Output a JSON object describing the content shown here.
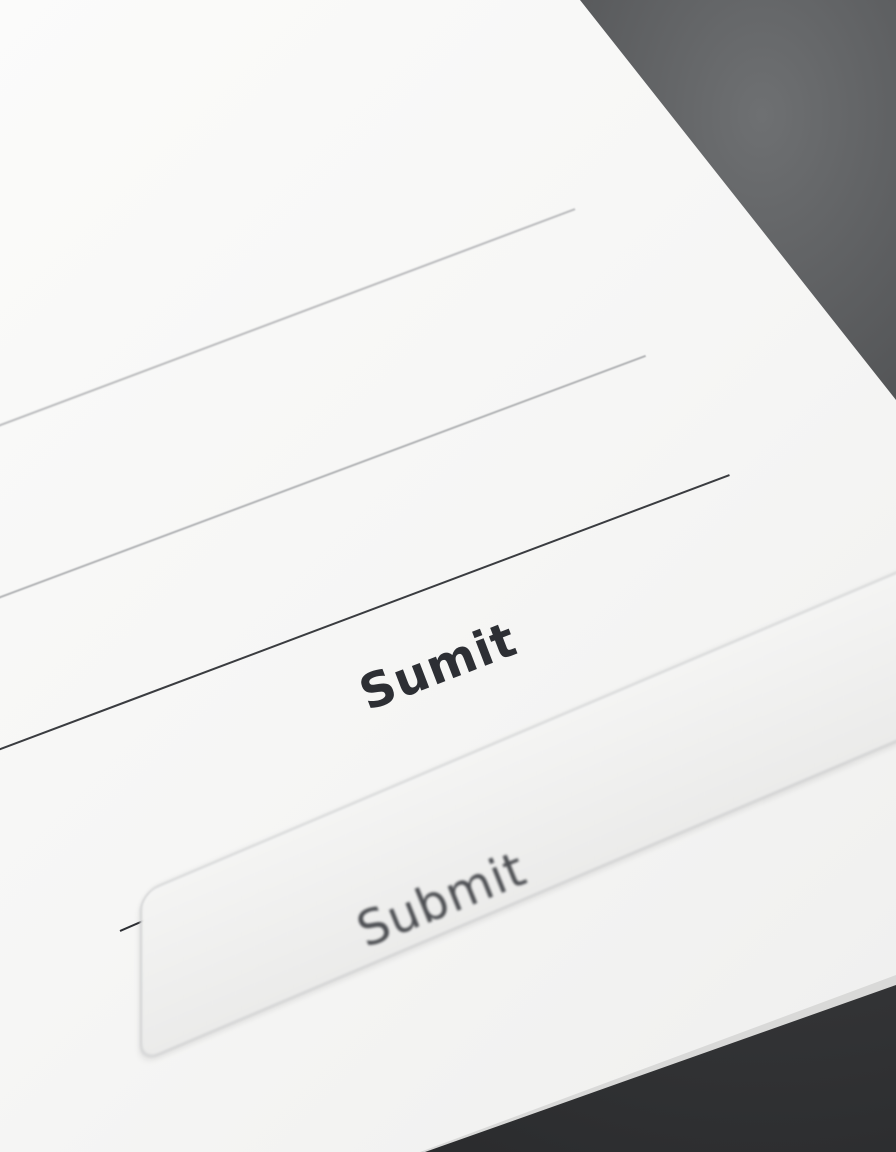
{
  "form": {
    "primary_button_label": "Sumit",
    "secondary_button_label": "Submit"
  }
}
